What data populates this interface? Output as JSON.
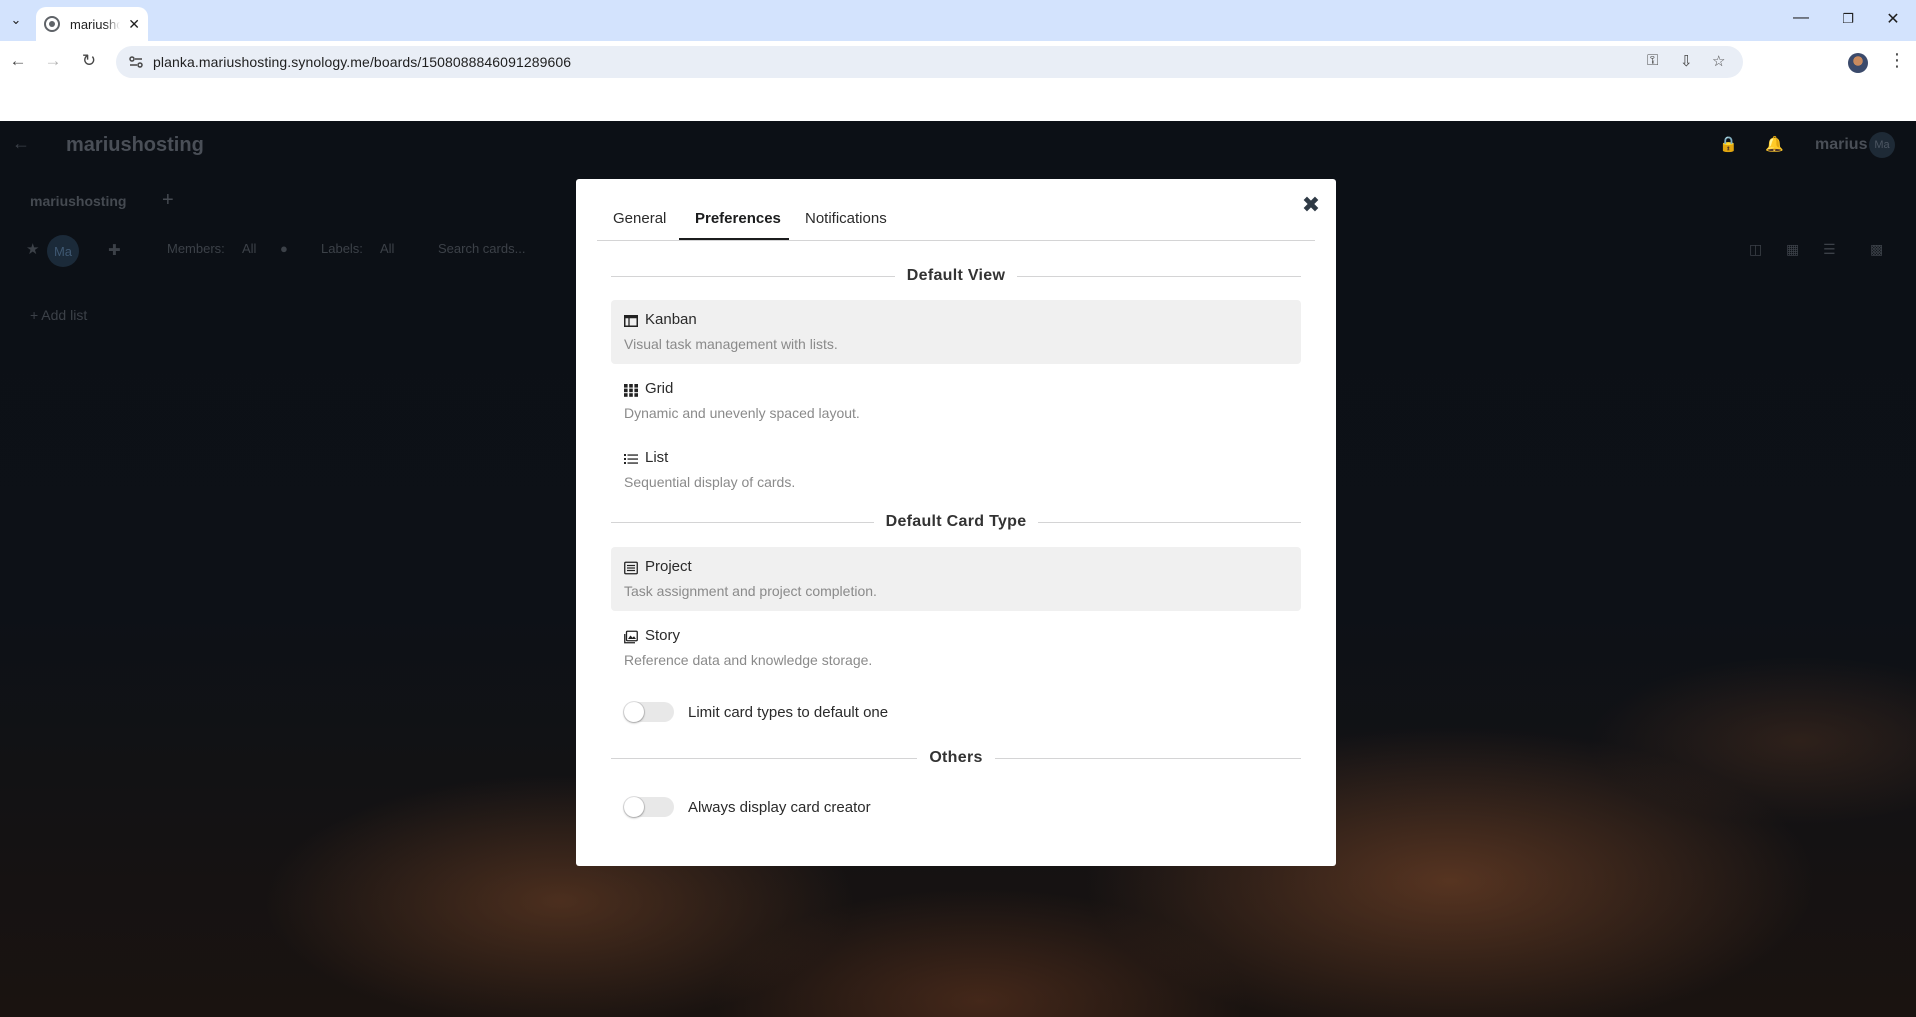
{
  "browser": {
    "tab_title": "mariushosting",
    "url": "planka.mariushosting.synology.me/boards/1508088846091289606"
  },
  "app": {
    "project_name": "mariushosting",
    "user_name": "marius",
    "user_initials": "Ma",
    "board_tab": "mariushosting",
    "filters": {
      "members_label": "Members:",
      "members_value": "All",
      "labels_label": "Labels:",
      "labels_value": "All",
      "search_placeholder": "Search cards..."
    },
    "add_list": "+ Add list"
  },
  "modal": {
    "tabs": [
      {
        "label": "General",
        "active": false
      },
      {
        "label": "Preferences",
        "active": true
      },
      {
        "label": "Notifications",
        "active": false
      }
    ],
    "sections": {
      "default_view": {
        "title": "Default View",
        "options": [
          {
            "icon": "kanban-icon",
            "title": "Kanban",
            "description": "Visual task management with lists.",
            "selected": true
          },
          {
            "icon": "grid-icon",
            "title": "Grid",
            "description": "Dynamic and unevenly spaced layout.",
            "selected": false
          },
          {
            "icon": "list-icon",
            "title": "List",
            "description": "Sequential display of cards.",
            "selected": false
          }
        ]
      },
      "default_card_type": {
        "title": "Default Card Type",
        "options": [
          {
            "icon": "project-icon",
            "title": "Project",
            "description": "Task assignment and project completion.",
            "selected": true
          },
          {
            "icon": "story-icon",
            "title": "Story",
            "description": "Reference data and knowledge storage.",
            "selected": false
          }
        ],
        "toggle": {
          "label": "Limit card types to default one",
          "on": false
        }
      },
      "others": {
        "title": "Others",
        "toggle": {
          "label": "Always display card creator",
          "on": false
        }
      }
    }
  },
  "colors": {
    "modal_bg": "#ffffff",
    "selected_option_bg": "#f0f0f0",
    "tabbar_bg": "#d3e3fd",
    "omnibox_bg": "#e9eef6"
  }
}
